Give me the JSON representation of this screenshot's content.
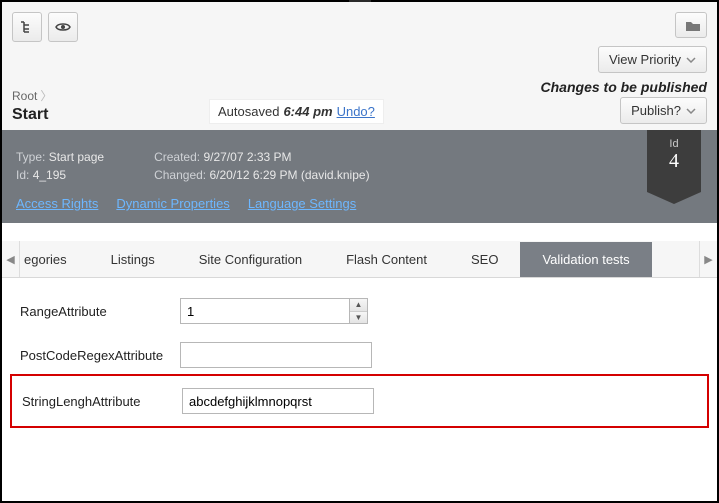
{
  "notch_glyph": "▼",
  "toolbar": {
    "tree_icon": "tree-icon",
    "eye_icon": "eye-icon",
    "folder_icon": "folder-icon",
    "view_priority_label": "View Priority"
  },
  "breadcrumb": {
    "root": "Root",
    "title": "Start"
  },
  "autosaved": {
    "label": "Autosaved",
    "time": "6:44 pm",
    "undo": "Undo?"
  },
  "changes": {
    "label": "Changes to be published",
    "publish_label": "Publish?"
  },
  "info": {
    "type_label": "Type:",
    "type_value": "Start page",
    "id_label": "Id:",
    "id_value": "4_195",
    "created_label": "Created:",
    "created_value": "9/27/07 2:33 PM",
    "changed_label": "Changed:",
    "changed_value": "6/20/12 6:29 PM (david.knipe)",
    "links": {
      "access": "Access Rights",
      "dynamic": "Dynamic Properties",
      "language": "Language Settings"
    },
    "flag_label": "Id",
    "flag_value": "4"
  },
  "tabs": {
    "cut": "egories",
    "items": [
      "Listings",
      "Site Configuration",
      "Flash Content",
      "SEO",
      "Validation tests"
    ],
    "active": "Validation tests"
  },
  "form": {
    "range_label": "RangeAttribute",
    "range_value": "1",
    "postcode_label": "PostCodeRegexAttribute",
    "postcode_value": "",
    "strlen_label": "StringLenghAttribute",
    "strlen_value": "abcdefghijklmnopqrst"
  }
}
